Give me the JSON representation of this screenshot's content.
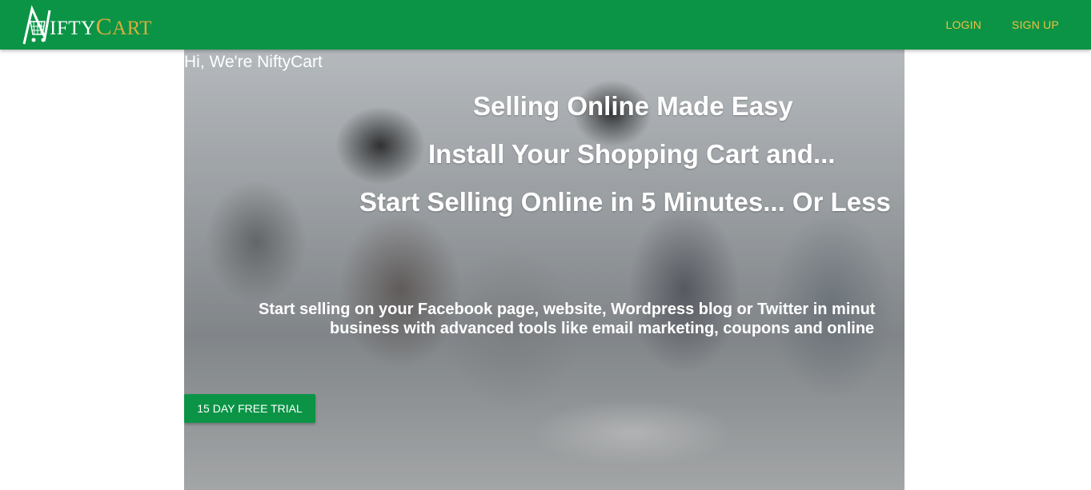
{
  "navbar": {
    "logo": {
      "initial": "N",
      "small_caps_1": "IFTY",
      "initial_2": "C",
      "small_caps_2": "ART"
    },
    "links": {
      "login": "LOGIN",
      "signup": "SIGN UP"
    }
  },
  "hero": {
    "greeting": "Hi, We're NiftyCart",
    "headlines": [
      "Selling Online Made Easy",
      "Install Your Shopping Cart and...",
      "Start Selling Online in 5 Minutes... Or Less"
    ],
    "description_lines": [
      "Start selling on your Facebook page, website, Wordpress blog or Twitter in minut",
      "business with advanced tools like email marketing, coupons and online"
    ],
    "cta_label": "15 DAY FREE TRIAL"
  },
  "colors": {
    "brand_green": "#0b9446",
    "logo_gold": "#d9ad3d",
    "nav_link": "#f0c040"
  }
}
